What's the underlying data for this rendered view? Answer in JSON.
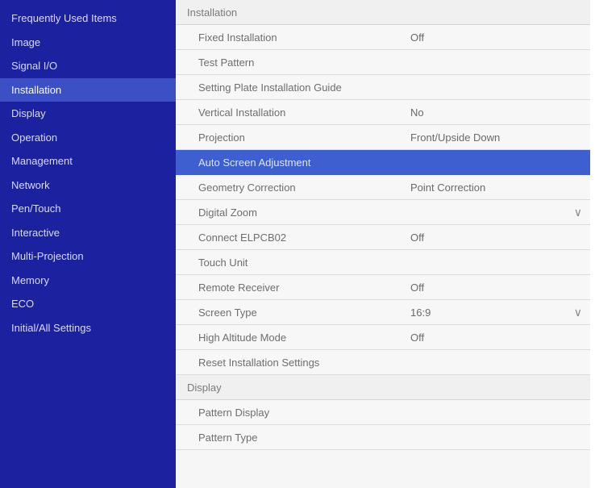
{
  "sidebar": {
    "items": [
      {
        "label": "Frequently Used Items",
        "selected": false
      },
      {
        "label": "Image",
        "selected": false
      },
      {
        "label": "Signal I/O",
        "selected": false
      },
      {
        "label": "Installation",
        "selected": true
      },
      {
        "label": "Display",
        "selected": false
      },
      {
        "label": "Operation",
        "selected": false
      },
      {
        "label": "Management",
        "selected": false
      },
      {
        "label": "Network",
        "selected": false
      },
      {
        "label": "Pen/Touch",
        "selected": false
      },
      {
        "label": "Interactive",
        "selected": false
      },
      {
        "label": "Multi-Projection",
        "selected": false
      },
      {
        "label": "Memory",
        "selected": false
      },
      {
        "label": "ECO",
        "selected": false
      },
      {
        "label": "Initial/All Settings",
        "selected": false
      }
    ]
  },
  "panel": {
    "installation_header": "Installation",
    "installation_rows": [
      {
        "label": "Fixed Installation",
        "value": "Off"
      },
      {
        "label": "Test Pattern",
        "value": ""
      },
      {
        "label": "Setting Plate Installation Guide",
        "value": ""
      },
      {
        "label": "Vertical Installation",
        "value": "No"
      },
      {
        "label": "Projection",
        "value": "Front/Upside Down"
      },
      {
        "label": "Auto Screen Adjustment",
        "value": "",
        "highlight": true
      },
      {
        "label": "Geometry Correction",
        "value": "Point Correction"
      },
      {
        "label": "Digital Zoom",
        "value": "",
        "chevron": true
      },
      {
        "label": "Connect ELPCB02",
        "value": "Off"
      },
      {
        "label": "Touch Unit",
        "value": ""
      },
      {
        "label": "Remote Receiver",
        "value": "Off"
      },
      {
        "label": "Screen Type",
        "value": "16:9",
        "chevron": true
      },
      {
        "label": "High Altitude Mode",
        "value": "Off"
      },
      {
        "label": "Reset Installation Settings",
        "value": ""
      }
    ],
    "display_header": "Display",
    "display_rows": [
      {
        "label": "Pattern Display",
        "value": ""
      },
      {
        "label": "Pattern Type",
        "value": ""
      }
    ]
  },
  "colors": {
    "sidebar_bg": "#1c219f",
    "sidebar_selected": "#3a50c4",
    "row_highlight": "#3d5fcf"
  }
}
